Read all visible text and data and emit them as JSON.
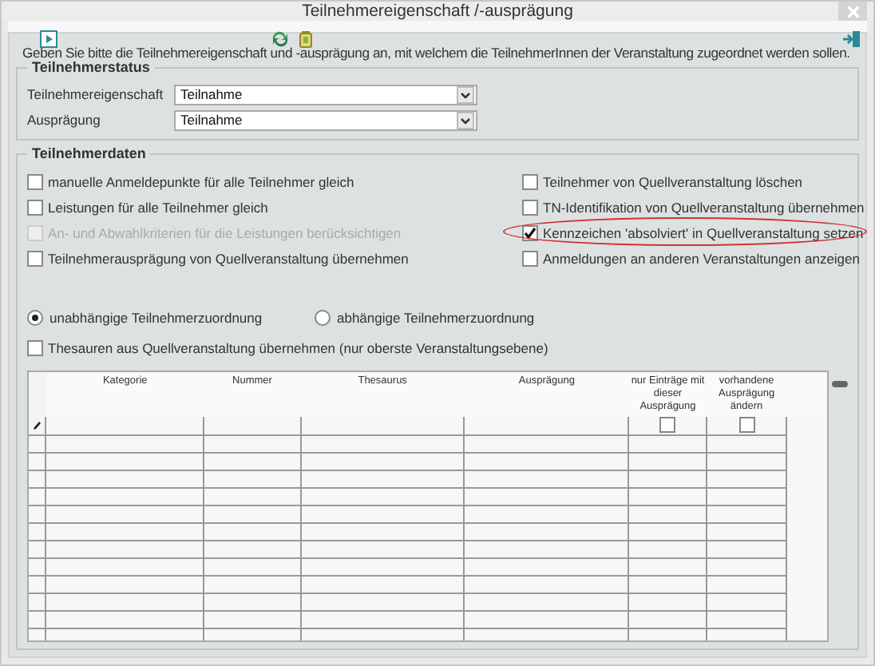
{
  "window": {
    "title": "Teilnehmereigenschaft /-ausprägung"
  },
  "instruction": "Geben Sie bitte die Teilnehmereigenschaft und -ausprägung an, mit welchem die TeilnehmerInnen der Veranstaltung zugeordnet werden sollen.",
  "status": {
    "legend": "Teilnehmerstatus",
    "fields": [
      {
        "label": "Teilnehmereigenschaft",
        "value": "Teilnahme"
      },
      {
        "label": "Ausprägung",
        "value": "Teilnahme"
      }
    ]
  },
  "data": {
    "legend": "Teilnehmerdaten",
    "options_left": [
      {
        "label": "manuelle Anmeldepunkte für alle Teilnehmer gleich",
        "checked": false,
        "disabled": false
      },
      {
        "label": "Leistungen für alle Teilnehmer gleich",
        "checked": false,
        "disabled": false
      },
      {
        "label": "An- und Abwahlkriterien für die Leistungen berücksichtigen",
        "checked": false,
        "disabled": true
      },
      {
        "label": "Teilnehmerausprägung von Quellveranstaltung übernehmen",
        "checked": false,
        "disabled": false
      }
    ],
    "options_right": [
      {
        "label": "Teilnehmer von Quellveranstaltung löschen",
        "checked": false,
        "disabled": false,
        "highlighted": false
      },
      {
        "label": "TN-Identifikation von Quellveranstaltung übernehmen",
        "checked": false,
        "disabled": false,
        "highlighted": false
      },
      {
        "label": "Kennzeichen 'absolviert' in Quellveranstaltung setzen",
        "checked": true,
        "disabled": false,
        "highlighted": true
      },
      {
        "label": "Anmeldungen an anderen Veranstaltungen anzeigen",
        "checked": false,
        "disabled": false,
        "highlighted": false
      }
    ],
    "radios": [
      {
        "label": "unabhängige Teilnehmerzuordnung",
        "selected": true
      },
      {
        "label": "abhängige Teilnehmerzuordnung",
        "selected": false
      }
    ],
    "thesaurus_option": {
      "label": "Thesauren aus Quellveranstaltung übernehmen (nur oberste Veranstaltungsebene)",
      "checked": false
    },
    "grid": {
      "columns": [
        {
          "label": "Kategorie",
          "kind": "text"
        },
        {
          "label": "Nummer",
          "kind": "text"
        },
        {
          "label": "Thesaurus",
          "kind": "text"
        },
        {
          "label": "Ausprägung",
          "kind": "text"
        },
        {
          "label": "nur Einträge mit dieser Ausprägung",
          "kind": "check",
          "checked": false
        },
        {
          "label": "vorhandene Ausprägung ändern",
          "kind": "check",
          "checked": false
        }
      ]
    }
  }
}
